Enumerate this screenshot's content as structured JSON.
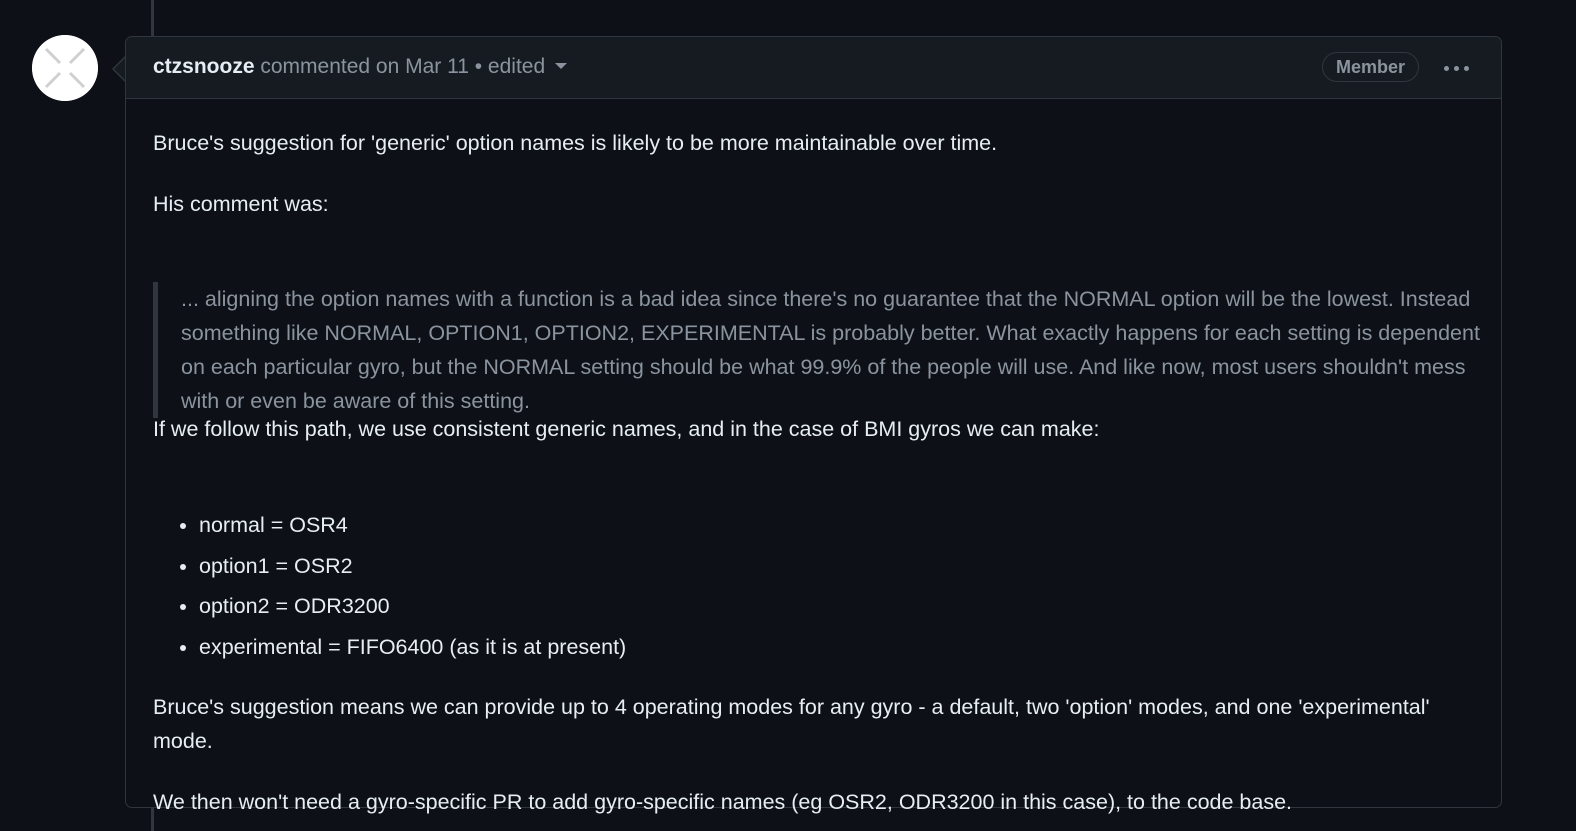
{
  "comment": {
    "author": "ctzsnooze",
    "meta": "commented on Mar 11 • edited",
    "badge": "Member",
    "paragraph_1": "Bruce's suggestion for 'generic' option names is likely to be more maintainable over time.",
    "paragraph_2": "His comment was:",
    "quote": "... aligning the option names with a function is a bad idea since there's no guarantee that the NORMAL option will be the lowest. Instead something like NORMAL, OPTION1, OPTION2, EXPERIMENTAL is probably better. What exactly happens for each setting is dependent on each particular gyro, but the NORMAL setting should be what 99.9% of the people will use. And like now, most users shouldn't mess with or even be aware of this setting.",
    "paragraph_3": "If we follow this path, we use consistent generic names, and in the case of BMI gyros we can make:",
    "bullets": [
      "normal = OSR4",
      "option1 = OSR2",
      "option2 = ODR3200",
      "experimental = FIFO6400 (as it is at present)"
    ],
    "paragraph_4": "Bruce's suggestion means we can provide up to 4 operating modes for any gyro - a default, two 'option' modes, and one 'experimental' mode.",
    "paragraph_5": "We then won't need a gyro-specific PR to add gyro-specific names (eg OSR2, ODR3200 in this case), to the code base."
  },
  "icons": {
    "avatar": "identicon-avatar",
    "edit_history": "triangle-down-icon",
    "more": "kebab-horizontal-icon"
  }
}
